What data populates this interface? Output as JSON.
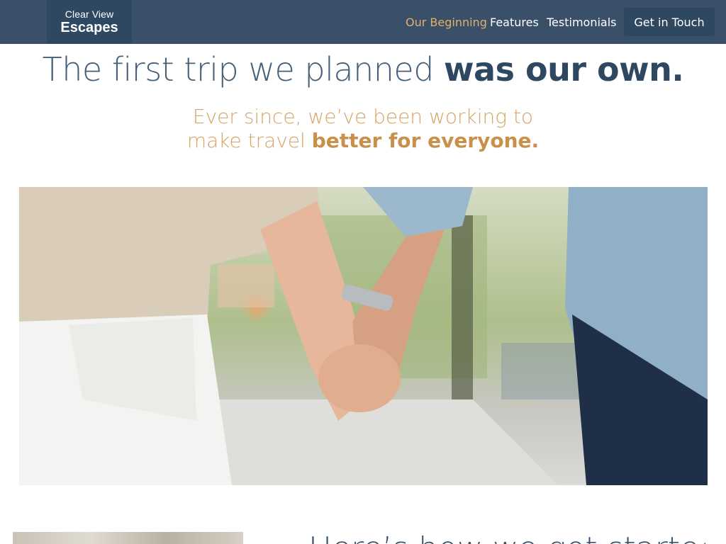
{
  "brand": {
    "name_line1": "Clear View",
    "name_line2": "Escapes"
  },
  "nav": {
    "items": [
      {
        "label": "Our Beginning",
        "active": true
      },
      {
        "label": "Features",
        "active": false
      },
      {
        "label": "Testimonials",
        "active": false
      }
    ],
    "cta_label": "Get in Touch"
  },
  "hero": {
    "headline_light": "The first trip we planned",
    "headline_bold": "was our own.",
    "sub_line1": "Ever since, we’ve been working to",
    "sub_line2_light": "make travel",
    "sub_line2_bold": "better for everyone."
  },
  "next_section": {
    "title_partial": "Here’s how we got started"
  },
  "colors": {
    "header_bg": "#3a5068",
    "accent_gold": "#d6a466",
    "heading_blue": "#2f4862"
  }
}
